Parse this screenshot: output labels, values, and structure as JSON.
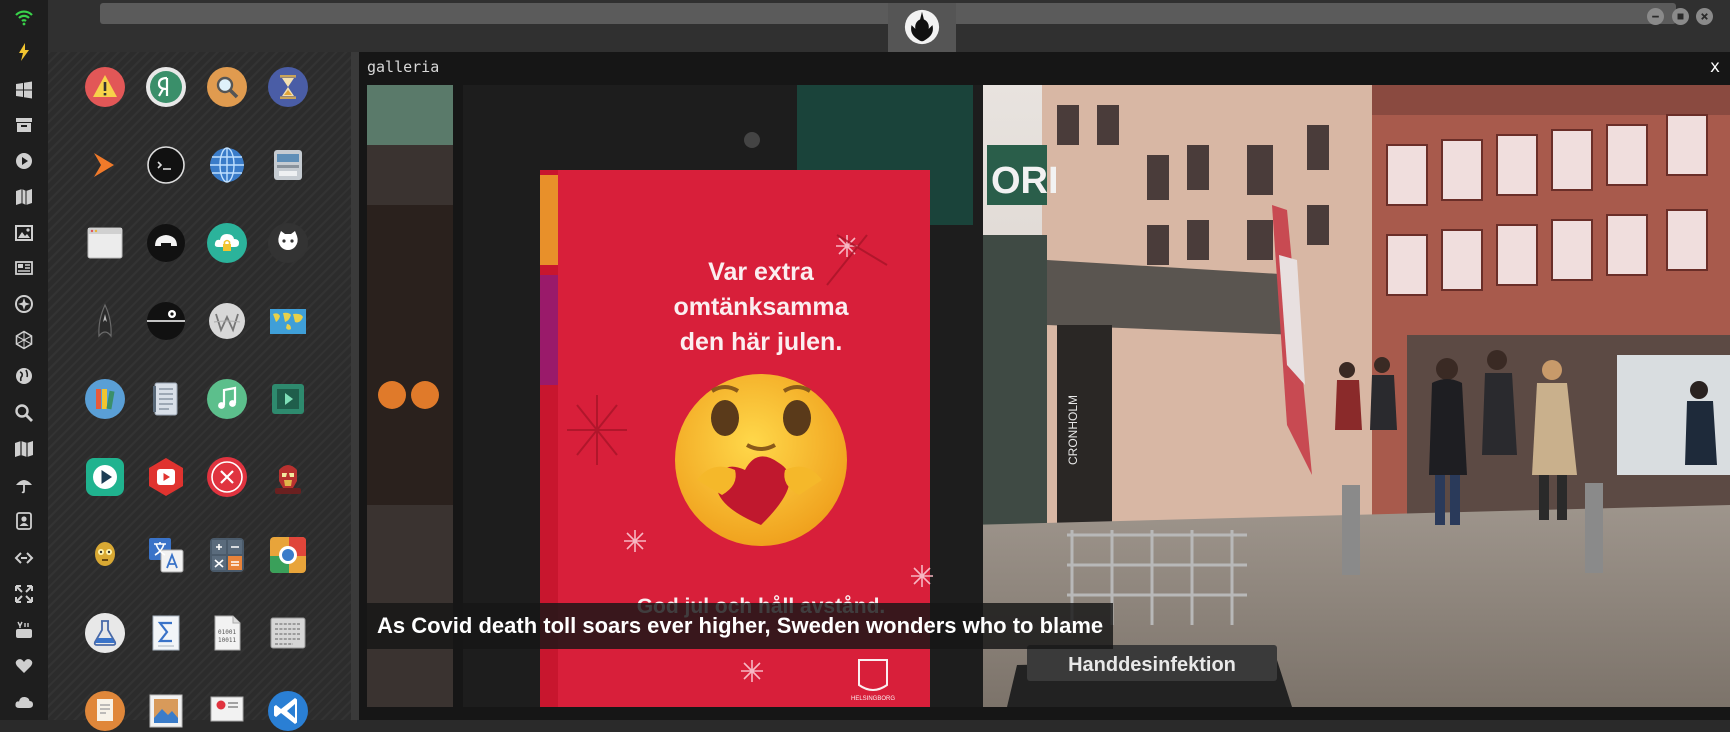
{
  "dock": {
    "items": [
      {
        "icon": "wifi-icon"
      },
      {
        "icon": "lightning-icon"
      },
      {
        "icon": "windows-icon"
      },
      {
        "icon": "archive-icon"
      },
      {
        "icon": "play-icon"
      },
      {
        "icon": "map-book-icon"
      },
      {
        "icon": "image-icon"
      },
      {
        "icon": "news-icon"
      },
      {
        "icon": "atom-icon"
      },
      {
        "icon": "hexagon-icon"
      },
      {
        "icon": "globe-icon"
      },
      {
        "icon": "search-icon"
      },
      {
        "icon": "map-icon"
      },
      {
        "icon": "umbrella-icon"
      },
      {
        "icon": "contacts-icon"
      },
      {
        "icon": "code-icon"
      },
      {
        "icon": "expand-icon"
      },
      {
        "icon": "youtube-icon"
      },
      {
        "icon": "heart-icon"
      },
      {
        "icon": "cloud-icon"
      }
    ]
  },
  "launcher": {
    "apps": [
      {
        "icon": "warning-icon",
        "color": "#e25757"
      },
      {
        "icon": "yandex-icon",
        "color": "#3a8f6a"
      },
      {
        "icon": "magnifier-icon",
        "color": "#e09b4f"
      },
      {
        "icon": "hourglass-icon",
        "color": "#4a5da6"
      },
      {
        "icon": "arrow-right-icon",
        "color": "#f07a2a"
      },
      {
        "icon": "terminal-icon",
        "color": "#111111"
      },
      {
        "icon": "globe-icon",
        "color": "#3a7cc9"
      },
      {
        "icon": "scanner-icon",
        "color": "#9aa3ad"
      },
      {
        "icon": "window-icon",
        "color": "#e8e8e8"
      },
      {
        "icon": "helmet-icon",
        "color": "#111111"
      },
      {
        "icon": "cloud-lock-icon",
        "color": "#2bb39b"
      },
      {
        "icon": "github-icon",
        "color": "#333333"
      },
      {
        "icon": "starfleet-icon",
        "color": "#222222"
      },
      {
        "icon": "death-star-icon",
        "color": "#111111"
      },
      {
        "icon": "wikipedia-icon",
        "color": "#d8d8d8"
      },
      {
        "icon": "world-map-icon",
        "color": "#3f9fd8"
      },
      {
        "icon": "books-icon",
        "color": "#5a9fd6"
      },
      {
        "icon": "notebook-icon",
        "color": "#d8dfe8"
      },
      {
        "icon": "music-icon",
        "color": "#5cbf8c"
      },
      {
        "icon": "video-icon",
        "color": "#2e8a6e"
      },
      {
        "icon": "player-icon",
        "color": "#20b38f"
      },
      {
        "icon": "youtube-app-icon",
        "color": "#e0332f"
      },
      {
        "icon": "close-circle-icon",
        "color": "#e0333f"
      },
      {
        "icon": "iron-man-icon",
        "color": "#b8312f"
      },
      {
        "icon": "c3po-icon",
        "color": "#d9a933"
      },
      {
        "icon": "translate-icon",
        "color": "#3a73c8"
      },
      {
        "icon": "calculator-icon",
        "color": "#4a5a6a"
      },
      {
        "icon": "chrome-icon",
        "color": "#e8a43a"
      },
      {
        "icon": "flask-icon",
        "color": "#e8e8e8"
      },
      {
        "icon": "sigma-icon",
        "color": "#dfe6ee"
      },
      {
        "icon": "binary-file-icon",
        "color": "#e8e8e8"
      },
      {
        "icon": "keyboard-icon",
        "color": "#bfbfbf"
      },
      {
        "icon": "document-icon",
        "color": "#e0873a"
      },
      {
        "icon": "picture-icon",
        "color": "#d89a5a"
      },
      {
        "icon": "presentation-icon",
        "color": "#d8d8d8"
      },
      {
        "icon": "vscode-icon",
        "color": "#2a7fd4"
      }
    ]
  },
  "topbar": {
    "logo": "rebel-alliance-icon"
  },
  "gallery": {
    "title": "galleria",
    "close_label": "x",
    "caption": "As Covid death toll soars ever higher, Sweden wonders who to blame",
    "photo": {
      "poster_lines": [
        "Var extra",
        "omtänksamma",
        "den här julen."
      ],
      "poster_footer": "God jul och håll avstånd.",
      "poster_logo_text": "HELSINGBORG",
      "store_sign": "CRONHOLM",
      "banner_text": "Handdesinfektion"
    }
  }
}
